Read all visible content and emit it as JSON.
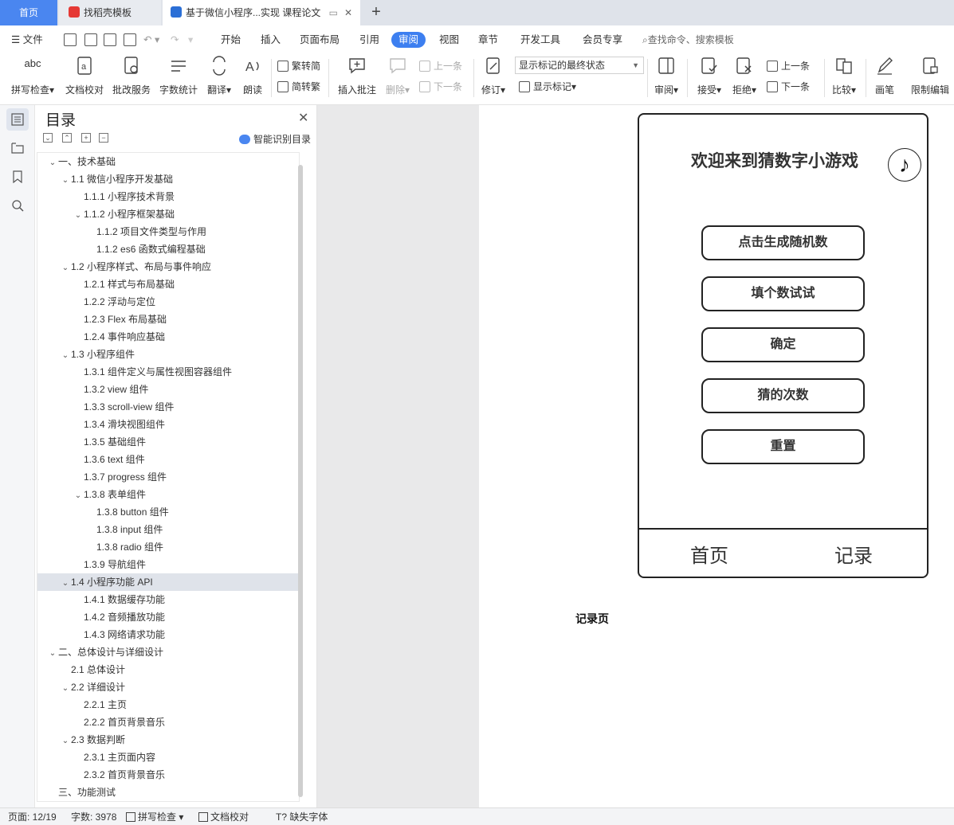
{
  "tabs": {
    "home": "首页",
    "template": "找稻壳模板",
    "document": "基于微信小程序...实现 课程论文"
  },
  "menu": {
    "file": "文件",
    "items": [
      "开始",
      "插入",
      "页面布局",
      "引用",
      "审阅",
      "视图",
      "章节",
      "开发工具",
      "会员专享"
    ],
    "active": "审阅",
    "search": "查找命令、搜索模板"
  },
  "toolbar": {
    "spell_check": "拼写检查",
    "spell_check_icon_text": "abc",
    "doc_proof": "文档校对",
    "correction_service": "批改服务",
    "word_count": "字数统计",
    "translate": "翻译",
    "read_aloud": "朗读",
    "trad_conv": "繁转简",
    "simp_conv": "简转繁",
    "insert_comment": "插入批注",
    "delete": "删除",
    "prev": "上一条",
    "next": "下一条",
    "revise": "修订",
    "markup_state": "显示标记的最终状态",
    "show_markup": "显示标记",
    "review": "审阅",
    "accept": "接受",
    "reject": "拒绝",
    "prev2": "上一条",
    "next2": "下一条",
    "compare": "比较",
    "pen": "画笔",
    "restrict": "限制编辑"
  },
  "toc": {
    "title": "目录",
    "smart": "智能识别目录",
    "items": [
      {
        "text": "一、技术基础",
        "level": 0,
        "chev": true
      },
      {
        "text": "1.1  微信小程序开发基础",
        "level": 1,
        "chev": true
      },
      {
        "text": "1.1.1  小程序技术背景",
        "level": 2,
        "chev": false
      },
      {
        "text": "1.1.2  小程序框架基础",
        "level": 2,
        "chev": true
      },
      {
        "text": "1.1.2  项目文件类型与作用",
        "level": 3,
        "chev": false
      },
      {
        "text": "1.1.2 es6  函数式编程基础",
        "level": 3,
        "chev": false
      },
      {
        "text": "1.2  小程序样式、布局与事件响应",
        "level": 1,
        "chev": true
      },
      {
        "text": "1.2.1  样式与布局基础",
        "level": 2,
        "chev": false
      },
      {
        "text": "1.2.2  浮动与定位",
        "level": 2,
        "chev": false
      },
      {
        "text": "1.2.3 Flex  布局基础",
        "level": 2,
        "chev": false
      },
      {
        "text": "1.2.4  事件响应基础",
        "level": 2,
        "chev": false
      },
      {
        "text": "1.3  小程序组件",
        "level": 1,
        "chev": true
      },
      {
        "text": "1.3.1  组件定义与属性视图容器组件",
        "level": 2,
        "chev": false
      },
      {
        "text": "1.3.2 view  组件",
        "level": 2,
        "chev": false
      },
      {
        "text": "1.3.3 scroll-view  组件",
        "level": 2,
        "chev": false
      },
      {
        "text": "1.3.4  滑块视图组件",
        "level": 2,
        "chev": false
      },
      {
        "text": "1.3.5  基础组件",
        "level": 2,
        "chev": false
      },
      {
        "text": "1.3.6 text  组件",
        "level": 2,
        "chev": false
      },
      {
        "text": "1.3.7 progress  组件",
        "level": 2,
        "chev": false
      },
      {
        "text": "1.3.8  表单组件",
        "level": 2,
        "chev": true
      },
      {
        "text": "1.3.8 button  组件",
        "level": 3,
        "chev": false
      },
      {
        "text": "1.3.8 input  组件",
        "level": 3,
        "chev": false
      },
      {
        "text": "1.3.8 radio  组件",
        "level": 3,
        "chev": false
      },
      {
        "text": "1.3.9  导航组件",
        "level": 2,
        "chev": false
      },
      {
        "text": "1.4  小程序功能  API",
        "level": 1,
        "chev": true,
        "selected": true
      },
      {
        "text": "1.4.1  数据缓存功能",
        "level": 2,
        "chev": false
      },
      {
        "text": "1.4.2  音频播放功能",
        "level": 2,
        "chev": false
      },
      {
        "text": "1.4.3  网络请求功能",
        "level": 2,
        "chev": false
      },
      {
        "text": "二、总体设计与详细设计",
        "level": 0,
        "chev": true
      },
      {
        "text": "2.1  总体设计",
        "level": 1,
        "chev": false
      },
      {
        "text": "2.2  详细设计",
        "level": 1,
        "chev": true
      },
      {
        "text": "2.2.1  主页",
        "level": 2,
        "chev": false
      },
      {
        "text": "2.2.2  首页背景音乐",
        "level": 2,
        "chev": false
      },
      {
        "text": "2.3  数据判断",
        "level": 1,
        "chev": true
      },
      {
        "text": "2.3.1  主页面内容",
        "level": 2,
        "chev": false
      },
      {
        "text": "2.3.2  首页背景音乐",
        "level": 2,
        "chev": false
      },
      {
        "text": "三、功能测试",
        "level": 0,
        "chev": false
      }
    ]
  },
  "phone": {
    "title": "欢迎来到猜数字小游戏",
    "music_glyph": "♪",
    "buttons": [
      "点击生成随机数",
      "填个数试试",
      "确定",
      "猜的次数",
      "重置"
    ],
    "nav_home": "首页",
    "nav_record": "记录"
  },
  "caption": "记录页",
  "status": {
    "page": "页面: 12/19",
    "words": "字数: 3978",
    "spell": "拼写检查",
    "proof": "文档校对",
    "missing_font": "缺失字体"
  }
}
